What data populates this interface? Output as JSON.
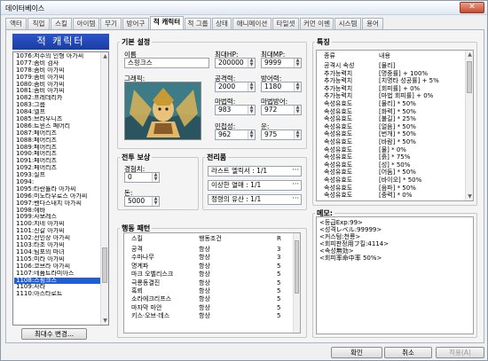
{
  "window": {
    "title": "데이터베이스",
    "close": "✕"
  },
  "tabs": [
    {
      "label": "액터"
    },
    {
      "label": "직업"
    },
    {
      "label": "스킬"
    },
    {
      "label": "아이템"
    },
    {
      "label": "무기"
    },
    {
      "label": "방어구"
    },
    {
      "label": "적 캐릭터",
      "active": true
    },
    {
      "label": "적 그룹"
    },
    {
      "label": "상태"
    },
    {
      "label": "애니메이션"
    },
    {
      "label": "타일셋"
    },
    {
      "label": "커먼 이벤트"
    },
    {
      "label": "시스템"
    },
    {
      "label": "용어"
    }
  ],
  "enemy_list": {
    "title": "적 캐릭터",
    "items": [
      "1076:저주의 인형 아가씨",
      "1077:좀비 검사",
      "1078:좀비 아가씨",
      "1079:좀비 아가씨",
      "1080:좀비 아가씨",
      "1081:좀비 아가씨",
      "1082:프레데리카",
      "1083:그룹",
      "1084:엘프",
      "1085:브라우니즈",
      "1086:트윈스 페어리",
      "1087:페어리즈",
      "1088:페어리즈",
      "1089:페어리즈",
      "1090:페어리즈",
      "1091:페어리즈",
      "1092:페어리즈",
      "1093:실프",
      "1094:",
      "1095:타란튤라 아가씨",
      "1096:미노타우로스 아가씨",
      "1097:벤다스내치 아가씨",
      "1098:에바",
      "1099:사보레스",
      "1100:지네 아가씨",
      "1101:진갈 아가씨",
      "1102:선인장 아가씨",
      "1103:타조 아가씨",
      "1104:팀포의 마녀",
      "1105:미라 아가씨",
      "1106:코브라 아가씨",
      "1107:네퓸트라미아스",
      "1108:스핑크스",
      "1109:사라",
      "1110:아스타로트"
    ],
    "selected_index": 32,
    "max_button": "최대수 변경..."
  },
  "general": {
    "group_label": "기본 설정",
    "name_label": "이름",
    "name": "스핑크스",
    "max_hp_label": "최대HP:",
    "max_hp": "200000",
    "max_mp_label": "최대MP:",
    "max_mp": "9999",
    "graphic_label": "그래픽:",
    "atk_label": "공격력:",
    "atk": "2000",
    "def_label": "방어력:",
    "def": "1180",
    "mat_label": "마법력:",
    "mat": "983",
    "mdf_label": "마법방어:",
    "mdf": "972",
    "agi_label": "민첩성:",
    "agi": "962",
    "luk_label": "운:",
    "luk": "975"
  },
  "rewards": {
    "group_label": "전투 보상",
    "exp_label": "경험치:",
    "exp": "0",
    "gold_label": "돈:",
    "gold": "5000"
  },
  "drops": {
    "group_label": "전리품",
    "items": [
      "라스트 엘릭서 : 1/1",
      "이상한 열매 : 1/1",
      "정령의 유산 : 1/1"
    ]
  },
  "actions": {
    "group_label": "행동 패턴",
    "headers": {
      "skill": "스킬",
      "condition": "행동조건",
      "rating": "R"
    },
    "rows": [
      {
        "skill": "공격",
        "condition": "항상",
        "rating": "3"
      },
      {
        "skill": "수마나무",
        "condition": "항상",
        "rating": "3"
      },
      {
        "skill": "명계파",
        "condition": "항상",
        "rating": "5"
      },
      {
        "skill": "마크 오벨리스크",
        "condition": "항상",
        "rating": "5"
      },
      {
        "skill": "극룡동결진",
        "condition": "항상",
        "rating": "5"
      },
      {
        "skill": "혹뢰",
        "condition": "항상",
        "rating": "5"
      },
      {
        "skill": "소라에크리프스",
        "condition": "항상",
        "rating": "5"
      },
      {
        "skill": "마자막 마안",
        "condition": "항상",
        "rating": "5"
      },
      {
        "skill": "키스·오브·데스",
        "condition": "항상",
        "rating": "5"
      }
    ]
  },
  "traits": {
    "group_label": "특징",
    "headers": {
      "type": "종류",
      "content": "내용"
    },
    "rows": [
      {
        "type": "공격시 속성",
        "content": "[물리]"
      },
      {
        "type": "추가능력치",
        "content": "[명중률] + 100%"
      },
      {
        "type": "추가능력치",
        "content": "[치명타 성공률] + 5%"
      },
      {
        "type": "추가능력치",
        "content": "[회피률] + 0%"
      },
      {
        "type": "추가능력치",
        "content": "[마법 회피률] + 0%"
      },
      {
        "type": "속성유효도",
        "content": "[물리] * 50%"
      },
      {
        "type": "속성유효도",
        "content": "[화력] * 50%"
      },
      {
        "type": "속성유효도",
        "content": "[불길] * 25%"
      },
      {
        "type": "속성유효도",
        "content": "[얼음] * 50%"
      },
      {
        "type": "속성유효도",
        "content": "[번개] * 50%"
      },
      {
        "type": "속성유효도",
        "content": "[바람] * 50%"
      },
      {
        "type": "속성유효도",
        "content": "[물] * 0%"
      },
      {
        "type": "속성유효도",
        "content": "[흙] * 75%"
      },
      {
        "type": "속성유효도",
        "content": "[성] * 50%"
      },
      {
        "type": "속성유효도",
        "content": "[어둠] * 50%"
      },
      {
        "type": "속성유효도",
        "content": "[바이오] * 50%"
      },
      {
        "type": "속성유효도",
        "content": "[음파] * 50%"
      },
      {
        "type": "속성유효도",
        "content": "[중력] * 0%"
      }
    ]
  },
  "memo": {
    "group_label": "메모:",
    "text": "<등급Exp:99>\n<성격レベル:99999>\n<커스텀:천룡>\n<회피판정用フ킬:4114>\n<속성無効>\n<회피率命中率 50%>"
  },
  "footer": {
    "ok": "확인",
    "cancel": "취소",
    "apply": "적용(A)"
  }
}
